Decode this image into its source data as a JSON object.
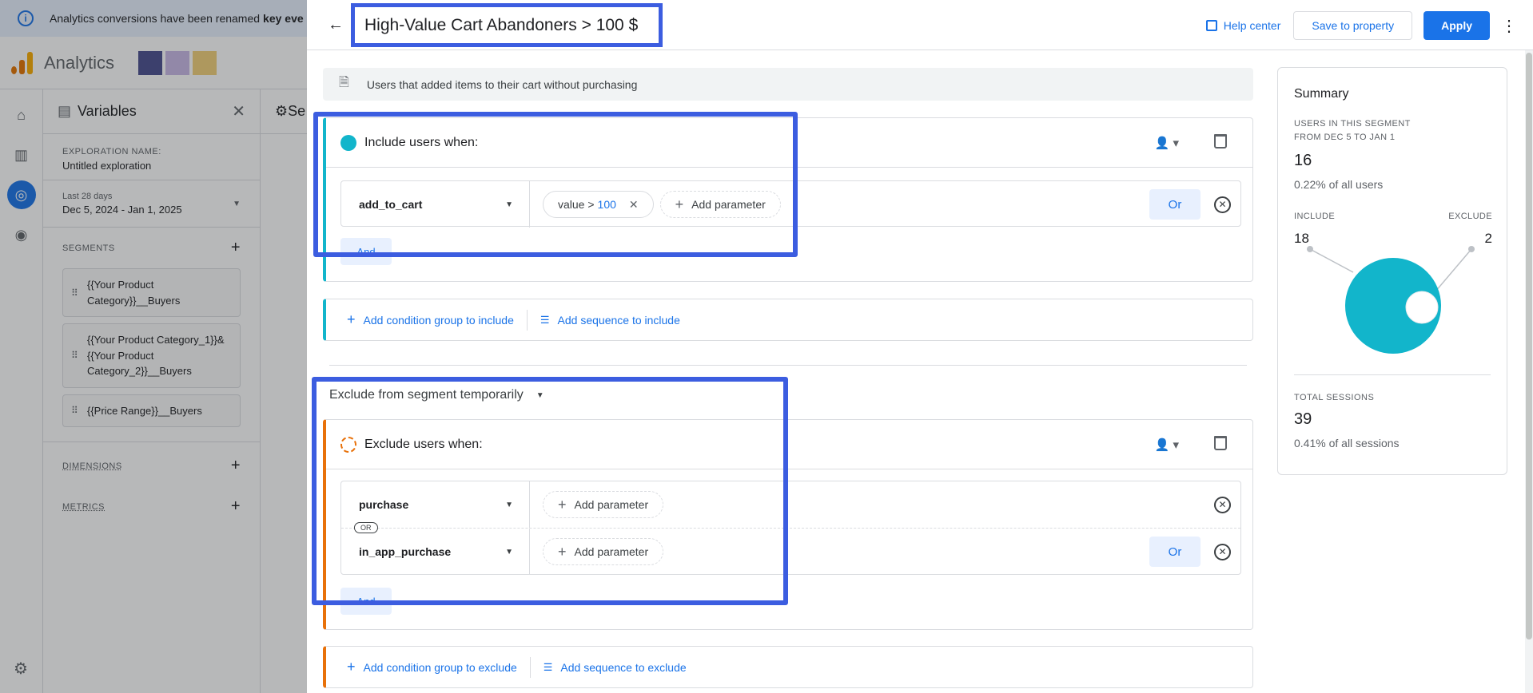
{
  "notice": {
    "text": "Analytics conversions have been renamed",
    "bold": "key eve"
  },
  "app": {
    "name": "Analytics"
  },
  "variables": {
    "title": "Variables",
    "exploration_label": "EXPLORATION NAME:",
    "exploration_name": "Untitled exploration",
    "date_preset": "Last 28 days",
    "date_range": "Dec 5, 2024 - Jan 1, 2025",
    "segments_label": "SEGMENTS",
    "segments": [
      {
        "label": "{{Your Product Category}}__Buyers"
      },
      {
        "label": "{{Your Product Category_1}}&{{Your Product Category_2}}__Buyers"
      },
      {
        "label": "{{Price Range}}__Buyers"
      }
    ],
    "dimensions_label": "DIMENSIONS",
    "metrics_label": "METRICS"
  },
  "settings_col": {
    "title": "Se"
  },
  "editor": {
    "segment_name": "High-Value Cart Abandoners > 100 $",
    "help_label": "Help center",
    "save_label": "Save to property",
    "apply_label": "Apply",
    "description": "Users that added items to their cart without purchasing",
    "include": {
      "title": "Include users when:",
      "event": "add_to_cart",
      "param_prefix": "value >",
      "param_value": "100",
      "add_param": "Add parameter",
      "or_label": "Or",
      "and_label": "And"
    },
    "add_group_include": "Add condition group to include",
    "add_seq_include": "Add sequence to include",
    "exclude_mode": "Exclude from segment temporarily",
    "exclude": {
      "title": "Exclude users when:",
      "event1": "purchase",
      "event2": "in_app_purchase",
      "or_pill": "OR",
      "add_param": "Add parameter",
      "or_label": "Or",
      "and_label": "And"
    },
    "add_group_exclude": "Add condition group to exclude",
    "add_seq_exclude": "Add sequence to exclude"
  },
  "summary": {
    "title": "Summary",
    "users_label_1": "USERS IN THIS SEGMENT",
    "users_label_2": "FROM DEC 5 TO JAN 1",
    "users_count": "16",
    "users_pct": "0.22% of all users",
    "include_label": "INCLUDE",
    "include_count": "18",
    "exclude_label": "EXCLUDE",
    "exclude_count": "2",
    "sessions_label": "TOTAL SESSIONS",
    "sessions_count": "39",
    "sessions_pct": "0.41% of all sessions"
  },
  "colors": {
    "accent": "#1a73e8",
    "include": "#12b5cb",
    "exclude": "#e8710a",
    "highlight": "#3c5de0"
  }
}
